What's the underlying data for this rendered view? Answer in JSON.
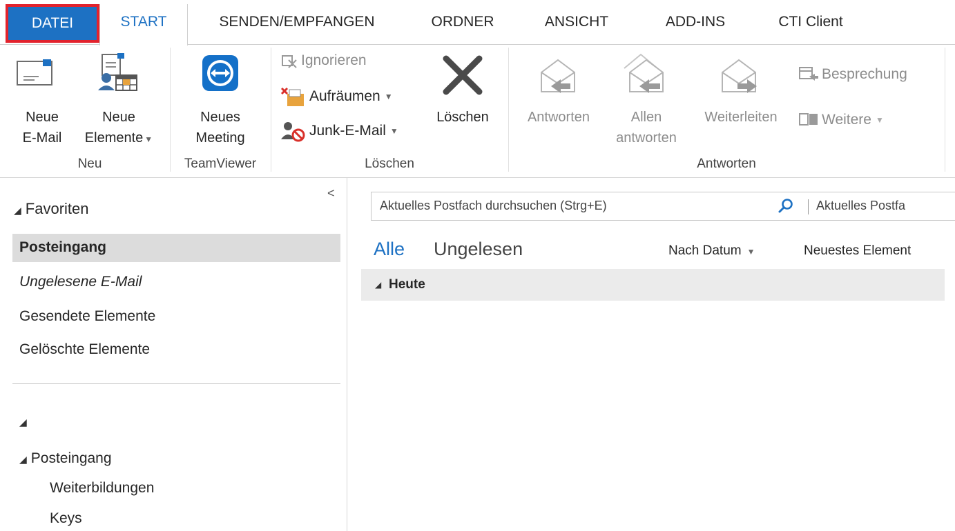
{
  "tabs": [
    {
      "label": "DATEI"
    },
    {
      "label": "START"
    },
    {
      "label": "SENDEN/EMPFANGEN"
    },
    {
      "label": "ORDNER"
    },
    {
      "label": "ANSICHT"
    },
    {
      "label": "ADD-INS"
    },
    {
      "label": "CTI Client"
    }
  ],
  "ribbon": {
    "neu": {
      "group_label": "Neu",
      "new_mail_line1": "Neue",
      "new_mail_line2": "E-Mail",
      "new_items_line1": "Neue",
      "new_items_line2": "Elemente"
    },
    "teamviewer": {
      "group_label": "TeamViewer",
      "meeting_line1": "Neues",
      "meeting_line2": "Meeting"
    },
    "loeschen": {
      "group_label": "Löschen",
      "ignore": "Ignorieren",
      "cleanup": "Aufräumen",
      "junk": "Junk-E-Mail",
      "delete": "Löschen"
    },
    "antworten": {
      "group_label": "Antworten",
      "reply": "Antworten",
      "reply_all_line1": "Allen",
      "reply_all_line2": "antworten",
      "forward": "Weiterleiten",
      "meeting": "Besprechung",
      "more": "Weitere"
    }
  },
  "nav": {
    "favorites_header": "Favoriten",
    "favorites": [
      {
        "label": "Posteingang"
      },
      {
        "label": "Ungelesene E-Mail"
      },
      {
        "label": "Gesendete Elemente"
      },
      {
        "label": "Gelöschte Elemente"
      }
    ],
    "account_header": "",
    "inbox_header": "Posteingang",
    "subfolders": [
      {
        "label": "Weiterbildungen"
      },
      {
        "label": "Keys"
      }
    ]
  },
  "mail_list": {
    "search_placeholder": "Aktuelles Postfach durchsuchen (Strg+E)",
    "search_scope": "Aktuelles Postfa",
    "filter_all": "Alle",
    "filter_unread": "Ungelesen",
    "sort_by": "Nach Datum",
    "sort_order": "Neuestes Element",
    "group_today": "Heute"
  },
  "colors": {
    "accent": "#1d71c3",
    "highlight_border": "#e2232d",
    "selected_bg": "#dcdcdc"
  }
}
